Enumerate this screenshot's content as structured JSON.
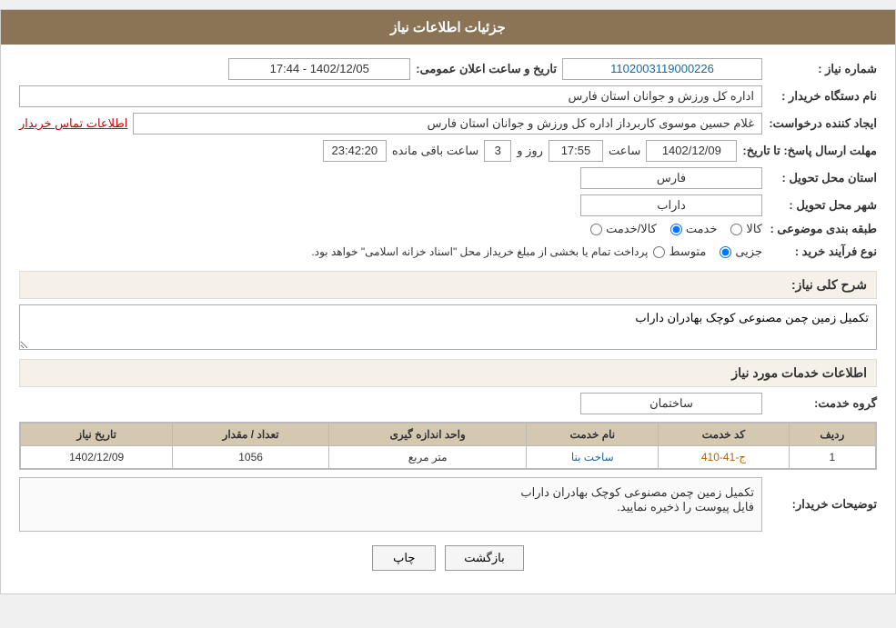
{
  "header": {
    "title": "جزئیات اطلاعات نیاز"
  },
  "form": {
    "need_number_label": "شماره نیاز :",
    "need_number_value": "1102003119000226",
    "announcement_label": "تاریخ و ساعت اعلان عمومی:",
    "announcement_value": "1402/12/05 - 17:44",
    "buyer_org_label": "نام دستگاه خریدار :",
    "buyer_org_value": "اداره کل ورزش و جوانان استان فارس",
    "creator_label": "ایجاد کننده درخواست:",
    "creator_value": "غلام حسین موسوی کاربرداز اداره کل ورزش و جوانان استان فارس",
    "contact_link": "اطلاعات تماس خریدار",
    "deadline_label": "مهلت ارسال پاسخ: تا تاریخ:",
    "deadline_date": "1402/12/09",
    "deadline_time_label": "ساعت",
    "deadline_time": "17:55",
    "deadline_days_label": "روز و",
    "deadline_days": "3",
    "deadline_remaining_label": "ساعت باقی مانده",
    "deadline_remaining": "23:42:20",
    "province_label": "استان محل تحویل :",
    "province_value": "فارس",
    "city_label": "شهر محل تحویل :",
    "city_value": "داراب",
    "category_label": "طبقه بندی موضوعی :",
    "category_options": [
      {
        "label": "کالا",
        "value": "kala"
      },
      {
        "label": "خدمت",
        "value": "khedmat"
      },
      {
        "label": "کالا/خدمت",
        "value": "kala_khedmat"
      }
    ],
    "category_selected": "khedmat",
    "process_label": "نوع فرآیند خرید :",
    "process_options": [
      {
        "label": "جزیی",
        "value": "jozei"
      },
      {
        "label": "متوسط",
        "value": "motavasset"
      }
    ],
    "process_selected": "jozei",
    "process_note": "پرداخت تمام یا بخشی از مبلغ خریداز محل \"اسناد خزانه اسلامی\" خواهد بود.",
    "need_desc_label": "شرح کلی نیاز:",
    "need_desc_value": "تکمیل زمین چمن مصنوعی کوچک بهادران داراب",
    "services_section_title": "اطلاعات خدمات مورد نیاز",
    "service_group_label": "گروه خدمت:",
    "service_group_value": "ساختمان",
    "table": {
      "headers": [
        "ردیف",
        "کد خدمت",
        "نام خدمت",
        "واحد اندازه گیری",
        "تعداد / مقدار",
        "تاریخ نیاز"
      ],
      "rows": [
        {
          "row": "1",
          "service_code": "ج-41-410",
          "service_name": "ساخت بنا",
          "unit": "متر مربع",
          "quantity": "1056",
          "date": "1402/12/09"
        }
      ]
    },
    "buyer_notes_label": "توضیحات خریدار:",
    "buyer_notes_value": "تکمیل زمین چمن مصنوعی کوچک بهادران داراب\nفایل پیوست را ذخیره نمایید."
  },
  "buttons": {
    "print_label": "چاپ",
    "back_label": "بازگشت"
  }
}
